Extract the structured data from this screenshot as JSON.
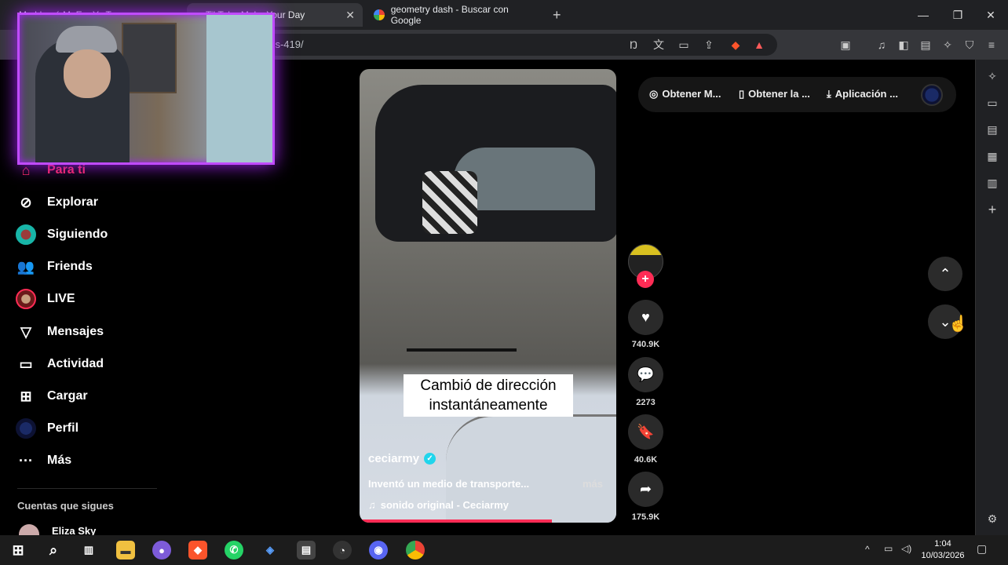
{
  "browser": {
    "tabs": [
      {
        "label": "Me Llamó M..Eo..Y...T..."
      },
      {
        "label": "TikTok - Make Your Day"
      },
      {
        "label": "geometry dash - Buscar con Google"
      }
    ],
    "url": "/...s-419/",
    "window_controls": [
      "minimize",
      "restore",
      "close"
    ]
  },
  "nav": {
    "items": [
      {
        "label": "Para ti",
        "icon": "home-icon"
      },
      {
        "label": "Explorar",
        "icon": "compass-icon"
      },
      {
        "label": "Siguiendo",
        "icon": "avatar"
      },
      {
        "label": "Friends",
        "icon": "friends-icon"
      },
      {
        "label": "LIVE",
        "icon": "live-icon"
      },
      {
        "label": "Mensajes",
        "icon": "send-icon"
      },
      {
        "label": "Actividad",
        "icon": "activity-icon"
      },
      {
        "label": "Cargar",
        "icon": "upload-icon"
      },
      {
        "label": "Perfil",
        "icon": "profile-icon"
      },
      {
        "label": "Más",
        "icon": "more-icon"
      }
    ],
    "following_header": "Cuentas que sigues",
    "following_first": "Eliza Sky"
  },
  "video": {
    "caption": "Cambió de dirección instantáneamente",
    "username": "ceciarmy",
    "description": "Inventó un medio de transporte...",
    "more_label": "más",
    "sound": "sonido original - Ceciarmy",
    "progress": 0.75
  },
  "actions": {
    "likes": "740.9K",
    "comments": "2273",
    "saves": "40.6K",
    "shares": "175.9K"
  },
  "getbar": {
    "items": [
      "Obtener M...",
      "Obtener la ...",
      "Aplicación ..."
    ]
  },
  "taskbar": {
    "time": "1:04",
    "date": "10/03/2026"
  },
  "colors": {
    "accent": "#fe2c55",
    "webcam_frame": "#c04bff",
    "verified": "#20d5ec"
  }
}
